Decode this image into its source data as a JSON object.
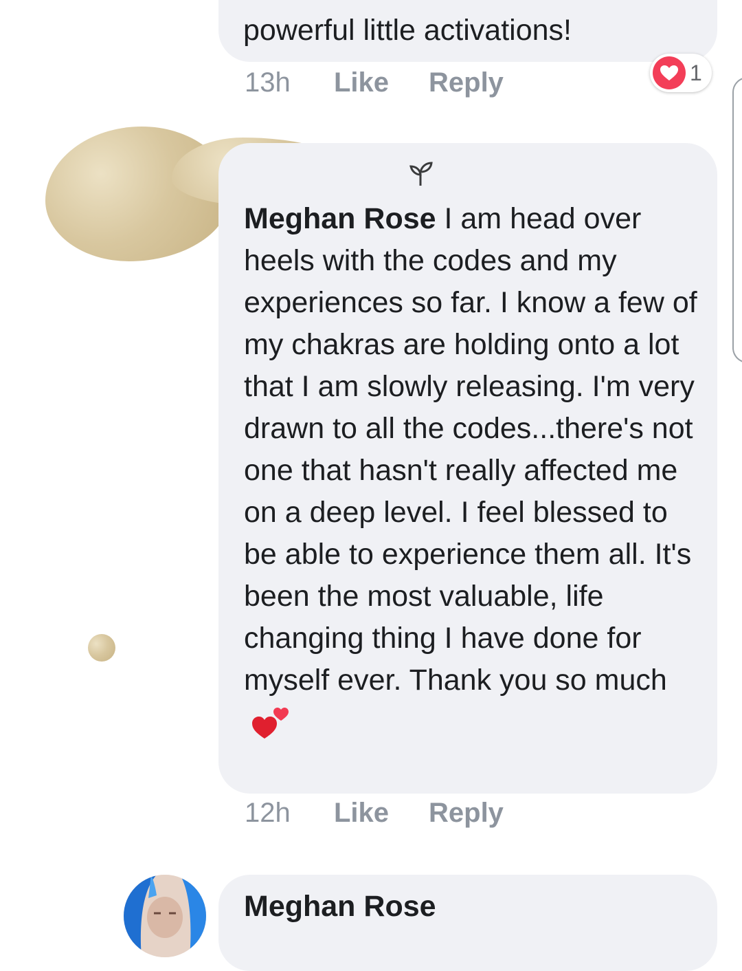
{
  "previous_comment": {
    "text_tail": "powerful little activations!",
    "time": "13h",
    "like_label": "Like",
    "reply_label": "Reply",
    "reaction_count": "1"
  },
  "main_comment": {
    "author": "Meghan Rose",
    "text": " I am head over heels with the codes and my experiences so far. I know a few of my chakras are holding onto a lot that I am slowly releasing. I'm very drawn to all the codes...there's not one that hasn't really affected me on a deep level. I feel blessed to be able to experience them all. It's been the most valuable, life changing thing I have done for myself ever. Thank you so much",
    "emoji": "two-hearts",
    "time": "12h",
    "like_label": "Like",
    "reply_label": "Reply"
  },
  "next_comment": {
    "author": "Meghan Rose"
  },
  "colors": {
    "bubble_bg": "#f0f1f5",
    "meta_text": "#8d949e",
    "heart_reaction": "#f33e58",
    "redaction_glitter": "#d8c79f"
  }
}
